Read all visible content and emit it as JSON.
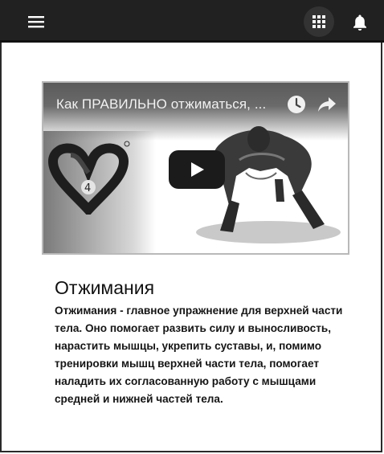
{
  "appbar": {
    "menu_icon": "menu-icon",
    "apps_icon": "apps-grid-icon",
    "notifications_icon": "bell-icon"
  },
  "video": {
    "title": "Как ПРАВИЛЬНО отжиматься, ...",
    "watch_later_icon": "clock-icon",
    "share_icon": "share-arrow-icon",
    "play_icon": "play-icon",
    "logo_badge": "4"
  },
  "card": {
    "title": "Отжимания",
    "description": "Отжимания - главное упражнение для верхней части тела. Оно помогает развить силу и выносливость, нарастить мышцы, укрепить суставы, и, помимо тренировки мышц верхней части тела, помогает наладить их согласованную работу с мышцами средней и нижней частей тела."
  }
}
